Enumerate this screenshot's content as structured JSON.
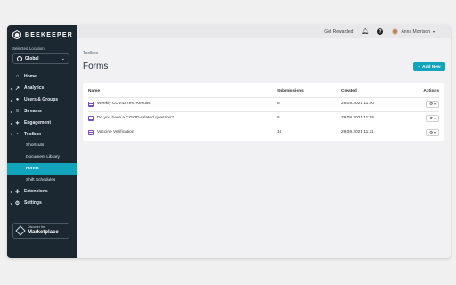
{
  "brand": {
    "name": "BEEKEEPER"
  },
  "sidebar": {
    "selected_location_label": "Selected Location",
    "location_value": "Global",
    "items": [
      {
        "label": "Home",
        "icon": "home-icon"
      },
      {
        "label": "Analytics",
        "icon": "analytics-icon"
      },
      {
        "label": "Users & Groups",
        "icon": "users-icon"
      },
      {
        "label": "Streams",
        "icon": "streams-icon"
      },
      {
        "label": "Engagement",
        "icon": "engagement-icon"
      },
      {
        "label": "Toolbox",
        "icon": "toolbox-icon"
      }
    ],
    "toolbox_subitems": [
      "Shortcuts",
      "Document Library",
      "Forms",
      "Shift Schedules"
    ],
    "bottom_items": [
      {
        "label": "Extensions",
        "icon": "extensions-icon"
      },
      {
        "label": "Settings",
        "icon": "settings-icon"
      }
    ],
    "marketplace": {
      "small": "Discover the",
      "big": "Marketplace"
    }
  },
  "topbar": {
    "get_rewarded": "Get Rewarded",
    "user_name": "Anna Morrison"
  },
  "main": {
    "breadcrumb": "Toolbox",
    "title": "Forms",
    "add_button": "Add New",
    "table": {
      "headers": {
        "name": "Name",
        "submissions": "Submissions",
        "created": "Created",
        "actions": "Actions"
      },
      "rows": [
        {
          "name": "Weekly COVID Test Results",
          "submissions": "8",
          "created": "29.09.2021 11:20"
        },
        {
          "name": "Do you have a COVID-related question?",
          "submissions": "6",
          "created": "29.09.2021 11:25"
        },
        {
          "name": "Vaccine Verification",
          "submissions": "16",
          "created": "29.09.2021 11:11"
        }
      ]
    }
  },
  "colors": {
    "accent": "#12a3bd",
    "sidebar": "#1b2832",
    "form_icon": "#7a4cc8"
  }
}
